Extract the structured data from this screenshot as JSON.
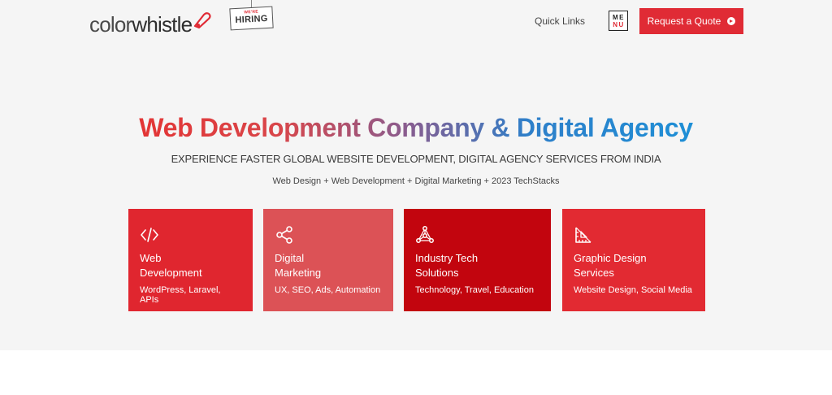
{
  "header": {
    "logo_light": "color",
    "logo_bold": "whistle",
    "hiring_small": "WE'RE",
    "hiring_big": "HIRING",
    "quick_links": "Quick Links",
    "menu_line1": "ME",
    "menu_line2": "NU",
    "quote_button": "Request a Quote"
  },
  "hero": {
    "headline": "Web Development Company & Digital Agency",
    "subhead": "EXPERIENCE FASTER GLOBAL WEBSITE DEVELOPMENT, DIGITAL AGENCY SERVICES FROM INDIA",
    "tagline": "Web Design + Web Development + Digital Marketing + 2023 TechStacks"
  },
  "cards": [
    {
      "title": "Web\nDevelopment",
      "desc": "WordPress, Laravel, APIs",
      "icon": "code-icon",
      "color": "#e0262f"
    },
    {
      "title": "Digital\nMarketing",
      "desc": "UX, SEO, Ads, Automation",
      "icon": "share-icon",
      "color": "#dc5256"
    },
    {
      "title": "Industry Tech\nSolutions",
      "desc": "Technology, Travel, Education",
      "icon": "network-icon",
      "color": "#c2050e"
    },
    {
      "title": "Graphic Design\nServices",
      "desc": "Website Design, Social Media",
      "icon": "design-ruler-icon",
      "color": "#e22a32"
    }
  ],
  "colors": {
    "accent": "#e02b35",
    "hero_bg": "#f5f5f5",
    "headline_start": "#e33535",
    "headline_end": "#1e8fd6"
  }
}
